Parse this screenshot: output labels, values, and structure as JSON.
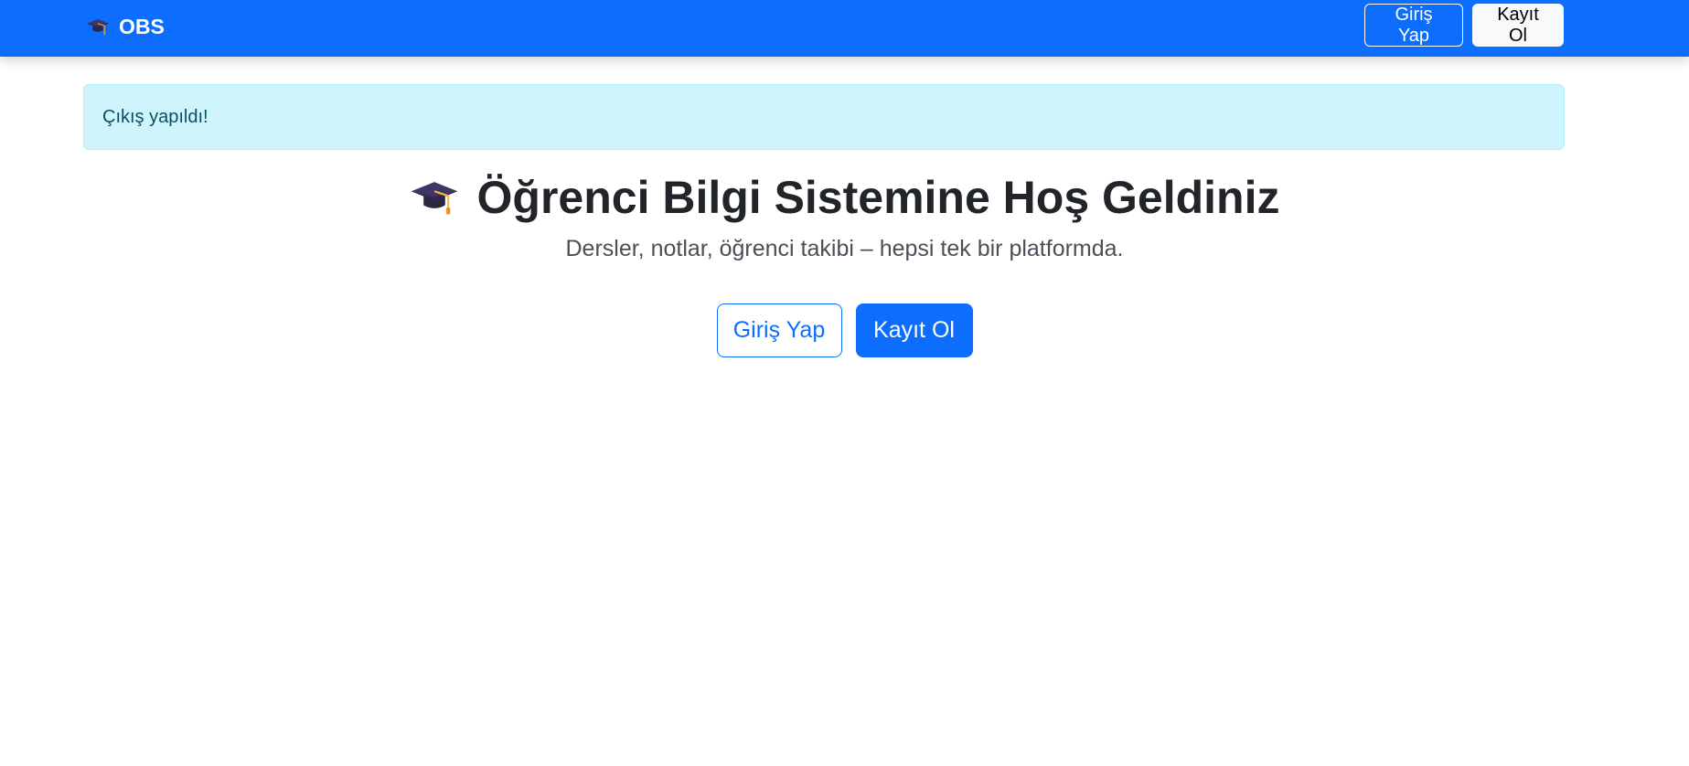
{
  "navbar": {
    "brand_icon": "graduation-cap-icon",
    "brand": "OBS",
    "login_label": "Giriş Yap",
    "register_label": "Kayıt Ol"
  },
  "alert": {
    "message": "Çıkış yapıldı!"
  },
  "hero": {
    "title_icon": "graduation-cap-icon",
    "title": "Öğrenci Bilgi Sistemine Hoş Geldiniz",
    "subtitle": "Dersler, notlar, öğrenci takibi – hepsi tek bir platformda.",
    "login_label": "Giriş Yap",
    "register_label": "Kayıt Ol"
  },
  "colors": {
    "primary": "#0d6efd",
    "alert_bg": "#cff4fc",
    "alert_text": "#055160",
    "heading": "#212529"
  }
}
